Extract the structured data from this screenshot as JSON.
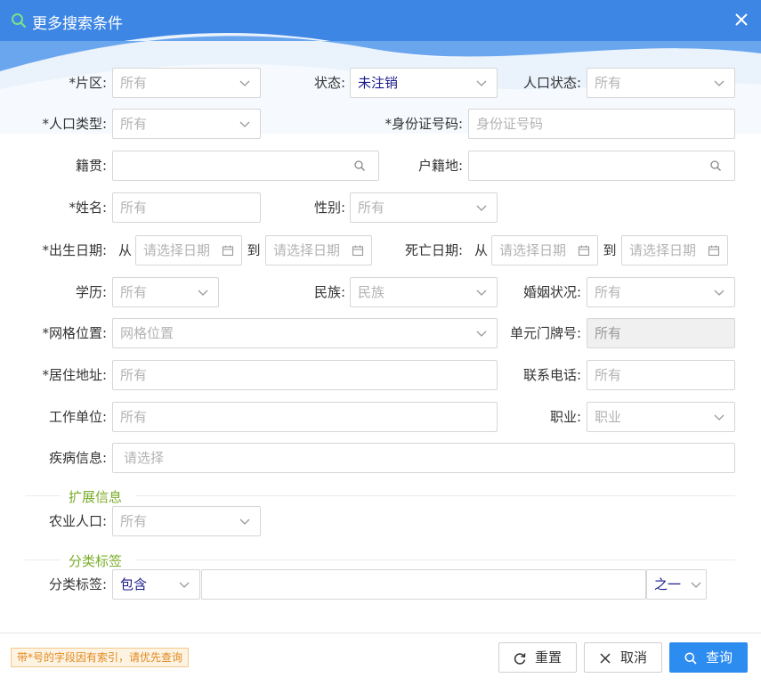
{
  "window": {
    "title": "更多搜索条件"
  },
  "rows": {
    "area": {
      "label": "*片区:",
      "placeholder": "所有"
    },
    "status": {
      "label": "状态:",
      "value": "未注销"
    },
    "pop_status": {
      "label": "人口状态:",
      "placeholder": "所有"
    },
    "pop_type": {
      "label": "*人口类型:",
      "placeholder": "所有"
    },
    "id_number": {
      "label": "*身份证号码:",
      "placeholder": "身份证号码"
    },
    "native_place": {
      "label": "籍贯:"
    },
    "domicile": {
      "label": "户籍地:"
    },
    "name": {
      "label": "*姓名:",
      "placeholder": "所有"
    },
    "gender": {
      "label": "性别:",
      "placeholder": "所有"
    },
    "birth_date": {
      "label": "*出生日期:",
      "from": "从",
      "to": "到",
      "placeholder": "请选择日期"
    },
    "death_date": {
      "label": "死亡日期:",
      "from": "从",
      "to": "到",
      "placeholder": "请选择日期"
    },
    "education": {
      "label": "学历:",
      "placeholder": "所有"
    },
    "ethnicity": {
      "label": "民族:",
      "placeholder": "民族"
    },
    "marital": {
      "label": "婚姻状况:",
      "placeholder": "所有"
    },
    "grid": {
      "label": "*网格位置:",
      "placeholder": "网格位置"
    },
    "unit_number": {
      "label": "单元门牌号:",
      "placeholder": "所有"
    },
    "address": {
      "label": "*居住地址:",
      "placeholder": "所有"
    },
    "phone": {
      "label": "联系电话:",
      "placeholder": "所有"
    },
    "employer": {
      "label": "工作单位:",
      "placeholder": "所有"
    },
    "occupation": {
      "label": "职业:",
      "placeholder": "职业"
    },
    "disease": {
      "label": "疾病信息:",
      "placeholder": "请选择"
    }
  },
  "extended": {
    "section_title": "扩展信息",
    "agri": {
      "label": "农业人口:",
      "placeholder": "所有"
    }
  },
  "tags": {
    "section_title": "分类标签",
    "label": "分类标签:",
    "mode_value": "包含",
    "match_value": "之一"
  },
  "footer": {
    "note": "带*号的字段因有索引，请优先查询",
    "reset_label": "重置",
    "cancel_label": "取消",
    "search_label": "查询"
  },
  "colors": {
    "title_bar": "#3d86e4",
    "primary_button": "#2d8cf0",
    "section_title": "#7aac2a",
    "note_text": "#e08a1e"
  }
}
